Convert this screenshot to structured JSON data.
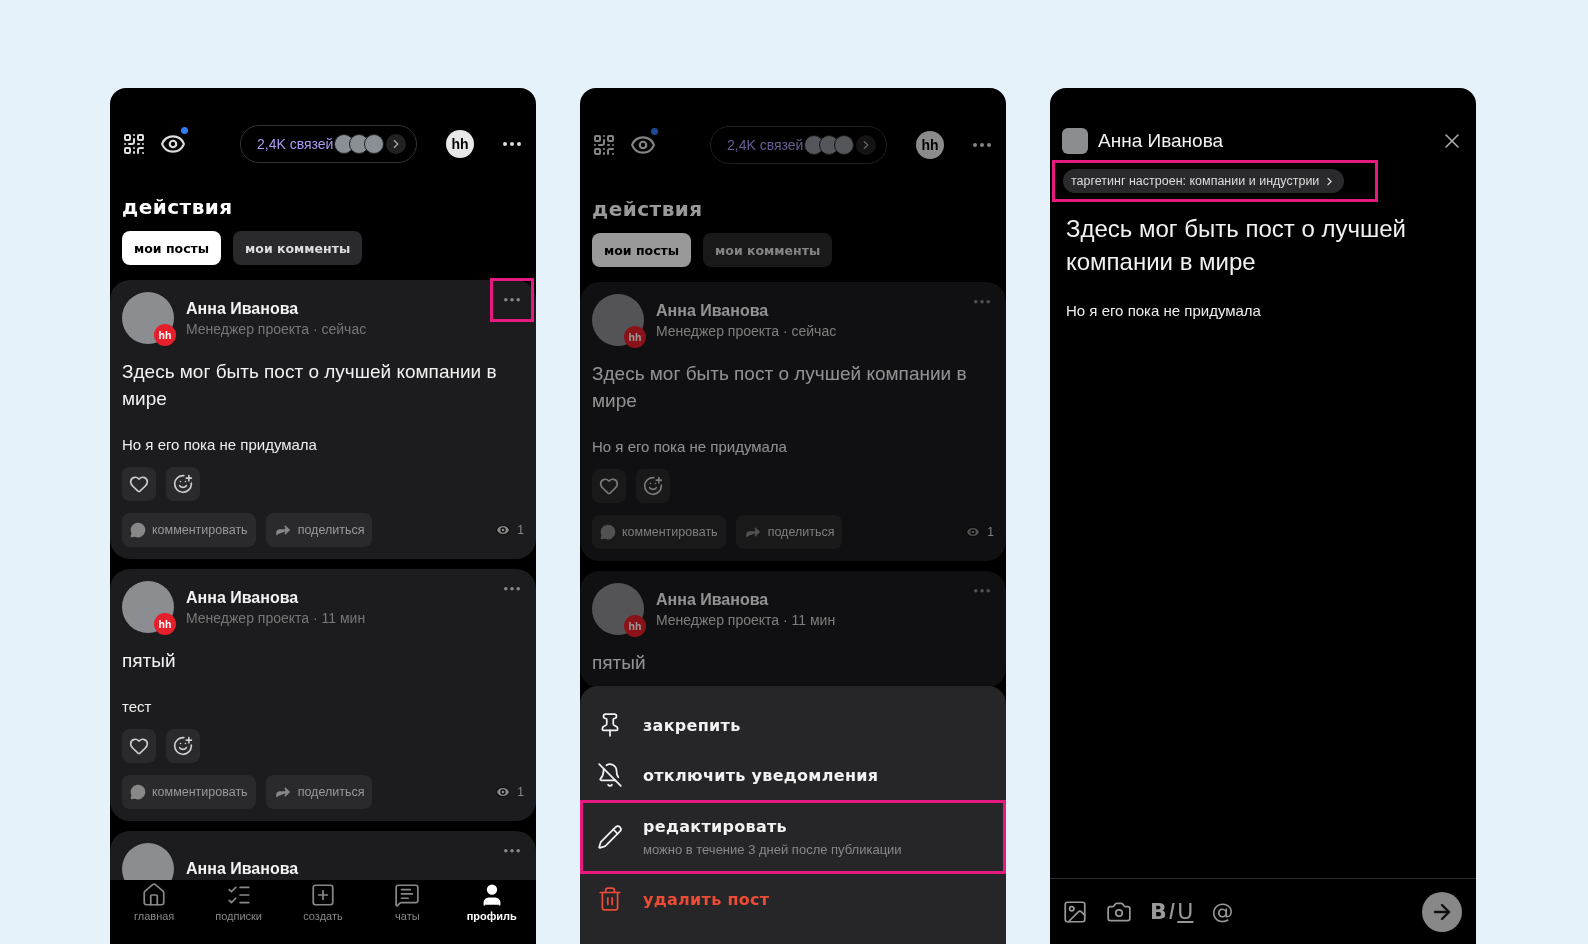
{
  "feed": {
    "header": {
      "connections": "2,4K связей",
      "brand": "hh"
    },
    "title": "действия",
    "tabs": [
      {
        "label": "мои посты",
        "selected": true
      },
      {
        "label": "мои комменты",
        "selected": false
      }
    ],
    "posts": [
      {
        "author": "Анна Иванова",
        "badge": "hh",
        "meta": "Менеджер проекта · сейчас",
        "more_highlighted": true,
        "title": "Здесь мог быть пост о лучшей компании в мире",
        "body": "Но я его пока не придумала",
        "comment": "комментировать",
        "share": "поделиться",
        "views": "1"
      },
      {
        "author": "Анна Иванова",
        "badge": "hh",
        "meta": "Менеджер проекта · 11 мин",
        "more_highlighted": false,
        "title": "пятый",
        "body": "тест",
        "comment": "комментировать",
        "share": "поделиться",
        "views": "1"
      },
      {
        "author": "Анна Иванова",
        "more_highlighted": false
      }
    ],
    "nav": [
      {
        "kind": "home",
        "label": "главная",
        "selected": false
      },
      {
        "kind": "subscriptions",
        "label": "подписки",
        "selected": false
      },
      {
        "kind": "create",
        "label": "создать",
        "selected": false
      },
      {
        "kind": "chats",
        "label": "чаты",
        "selected": false
      },
      {
        "kind": "profile",
        "label": "профиль",
        "selected": true
      }
    ]
  },
  "dimmed_feed": {
    "header": {
      "connections": "2,4K связей",
      "brand": "hh"
    },
    "title": "действия",
    "tabs": [
      {
        "label": "мои посты",
        "selected": true
      },
      {
        "label": "мои комменты",
        "selected": false
      }
    ],
    "posts": [
      {
        "author": "Анна Иванова",
        "badge": "hh",
        "meta": "Менеджер проекта · сейчас",
        "more_highlighted": false,
        "title": "Здесь мог быть пост о лучшей компании в мире",
        "body": "Но я его пока не придумала",
        "comment": "комментировать",
        "share": "поделиться",
        "views": "1"
      },
      {
        "author": "Анна Иванова",
        "badge": "hh",
        "meta": "Менеджер проекта · 11 мин",
        "more_highlighted": false,
        "title": "пятый"
      }
    ]
  },
  "menu": {
    "items": [
      {
        "kind": "pin",
        "label": "закрепить",
        "highlighted": false
      },
      {
        "kind": "mute",
        "label": "отключить уведомления",
        "highlighted": false
      },
      {
        "kind": "edit",
        "label": "редактировать",
        "hint": "можно в течение 3 дней после публикации",
        "highlighted": true
      },
      {
        "kind": "delete",
        "label": "удалить пост",
        "highlighted": false
      }
    ]
  },
  "editor": {
    "author": "Анна Иванова",
    "targeting": {
      "label": "таргетинг настроен: компании и индустрии",
      "highlighted": true
    },
    "title": "Здесь мог быть пост о лучшей компании в мире",
    "body": "Но я его пока не придумала",
    "toolbar": [
      {
        "kind": "image"
      },
      {
        "kind": "camera"
      },
      {
        "kind": "bold",
        "label": "B"
      },
      {
        "kind": "italic",
        "label": "I"
      },
      {
        "kind": "underline",
        "label": "U"
      },
      {
        "kind": "mention",
        "label": "@"
      }
    ]
  }
}
